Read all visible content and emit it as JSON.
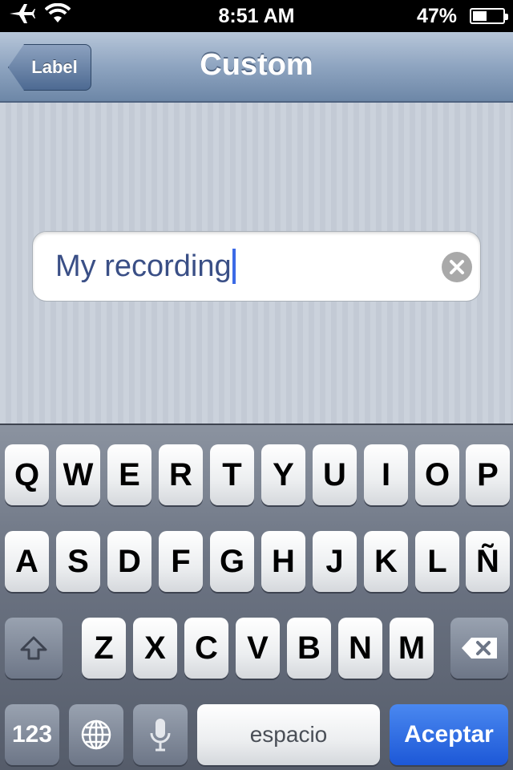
{
  "status_bar": {
    "time": "8:51 AM",
    "battery_text": "47%",
    "battery_level": 0.47,
    "icons": [
      "airplane-icon",
      "wifi-icon",
      "battery-icon"
    ]
  },
  "nav": {
    "back_label": "Label",
    "title": "Custom"
  },
  "text_field": {
    "value": "My recording",
    "clear_icon": "clear-icon"
  },
  "keyboard": {
    "row1": [
      "Q",
      "W",
      "E",
      "R",
      "T",
      "Y",
      "U",
      "I",
      "O",
      "P"
    ],
    "row2": [
      "A",
      "S",
      "D",
      "F",
      "G",
      "H",
      "J",
      "K",
      "L",
      "Ñ"
    ],
    "row3": [
      "Z",
      "X",
      "C",
      "V",
      "B",
      "N",
      "M"
    ],
    "numbers_label": "123",
    "space_label": "espacio",
    "return_label": "Aceptar"
  },
  "colors": {
    "accent": "#1d58d7",
    "field_text": "#3a4f86",
    "cursor": "#3c6ae6"
  }
}
